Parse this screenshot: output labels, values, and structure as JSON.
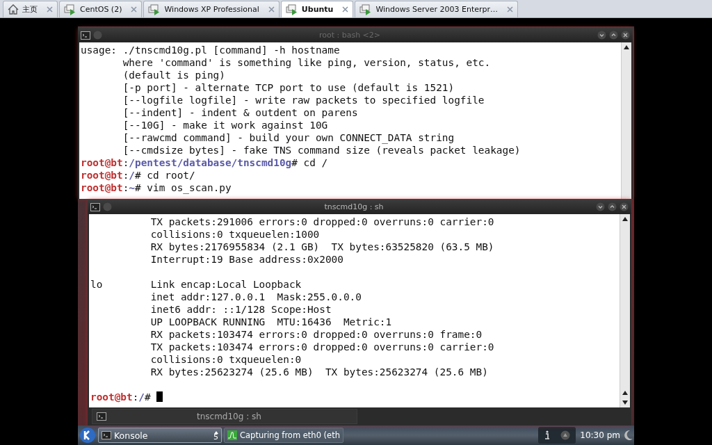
{
  "browser_tabs": [
    {
      "label": "主页",
      "kind": "home",
      "selected": false
    },
    {
      "label": "CentOS (2)",
      "kind": "vm",
      "selected": false
    },
    {
      "label": "Windows XP Professional",
      "kind": "vm",
      "selected": false
    },
    {
      "label": "Ubuntu",
      "kind": "vm",
      "selected": true
    },
    {
      "label": "Windows Server 2003 Enterpr…",
      "kind": "vm",
      "selected": false
    }
  ],
  "back_window": {
    "title": "root : bash <2>",
    "lines": [
      {
        "kind": "text",
        "text": "usage: ./tnscmd10g.pl [command] -h hostname"
      },
      {
        "kind": "text",
        "text": "       where 'command' is something like ping, version, status, etc."
      },
      {
        "kind": "text",
        "text": "       (default is ping)"
      },
      {
        "kind": "text",
        "text": "       [-p port] - alternate TCP port to use (default is 1521)"
      },
      {
        "kind": "text",
        "text": "       [--logfile logfile] - write raw packets to specified logfile"
      },
      {
        "kind": "text",
        "text": "       [--indent] - indent & outdent on parens"
      },
      {
        "kind": "text",
        "text": "       [--10G] - make it work against 10G"
      },
      {
        "kind": "text",
        "text": "       [--rawcmd command] - build your own CONNECT_DATA string"
      },
      {
        "kind": "text",
        "text": "       [--cmdsize bytes] - fake TNS command size (reveals packet leakage)"
      },
      {
        "kind": "prompt",
        "user": "root@bt",
        "sep": ":",
        "path": "/pentest/database/tnscmd10g",
        "command": "# cd /",
        "cursor": false
      },
      {
        "kind": "prompt",
        "user": "root@bt",
        "sep": ":",
        "path": "/",
        "command": "# cd root/",
        "cursor": false
      },
      {
        "kind": "prompt",
        "user": "root@bt",
        "sep": ":",
        "path": "~",
        "command": "# vim os_scan.py",
        "cursor": false
      }
    ]
  },
  "front_window": {
    "title": "tnscmd10g : sh",
    "lines": [
      {
        "kind": "text",
        "text": "          TX packets:291006 errors:0 dropped:0 overruns:0 carrier:0"
      },
      {
        "kind": "text",
        "text": "          collisions:0 txqueuelen:1000"
      },
      {
        "kind": "text",
        "text": "          RX bytes:2176955834 (2.1 GB)  TX bytes:63525820 (63.5 MB)"
      },
      {
        "kind": "text",
        "text": "          Interrupt:19 Base address:0x2000"
      },
      {
        "kind": "blank"
      },
      {
        "kind": "text",
        "text": "lo        Link encap:Local Loopback"
      },
      {
        "kind": "text",
        "text": "          inet addr:127.0.0.1  Mask:255.0.0.0"
      },
      {
        "kind": "text",
        "text": "          inet6 addr: ::1/128 Scope:Host"
      },
      {
        "kind": "text",
        "text": "          UP LOOPBACK RUNNING  MTU:16436  Metric:1"
      },
      {
        "kind": "text",
        "text": "          RX packets:103474 errors:0 dropped:0 overruns:0 frame:0"
      },
      {
        "kind": "text",
        "text": "          TX packets:103474 errors:0 dropped:0 overruns:0 carrier:0"
      },
      {
        "kind": "text",
        "text": "          collisions:0 txqueuelen:0"
      },
      {
        "kind": "text",
        "text": "          RX bytes:25623274 (25.6 MB)  TX bytes:25623274 (25.6 MB)"
      },
      {
        "kind": "blank"
      },
      {
        "kind": "prompt",
        "user": "root@bt",
        "sep": ":",
        "path": "/",
        "command": "# ",
        "cursor": true
      }
    ],
    "session_tab": "tnscmd10g : sh"
  },
  "taskbar": {
    "tasks": [
      {
        "label": "Konsole",
        "kind": "konsole",
        "count": "5",
        "selected": true
      },
      {
        "label": "Capturing from eth0 (eth",
        "kind": "capture",
        "selected": false
      }
    ],
    "clock": "10:30 pm"
  }
}
